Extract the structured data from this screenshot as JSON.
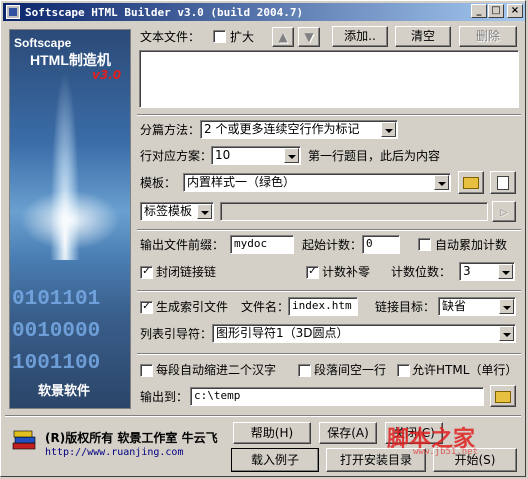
{
  "window": {
    "title": "Softscape HTML Builder v3.0 (build 2004.7)",
    "controls": [
      "_",
      "□",
      "×"
    ]
  },
  "sidebar": {
    "brand": "Softscape",
    "product": "HTML制造机",
    "version": "v3.0",
    "binary_lines": [
      "0101101",
      "0010000",
      "1001100"
    ],
    "company": "软景软件"
  },
  "text_files": {
    "label": "文本文件：",
    "expand_label": "扩大",
    "expand_checked": false,
    "up_icon": "up-arrow-icon",
    "down_icon": "down-arrow-icon",
    "add_label": "添加..",
    "clear_label": "清空",
    "delete_label": "删除"
  },
  "split": {
    "label": "分篇方法：",
    "value": "2 个或更多连续空行作为标记"
  },
  "line_map": {
    "label": "行对应方案：",
    "value": "10",
    "description": "第一行题目，此后为内容"
  },
  "template": {
    "label": "模板：",
    "value": "内置样式一（绿色）",
    "open_icon": "folder-open-icon",
    "preview_icon": "preview-icon"
  },
  "tag_template": {
    "value": "标签模板",
    "play_icon": "play-icon"
  },
  "output_prefix": {
    "label": "输出文件前缀：",
    "value": "mydoc",
    "start_label": "起始计数：",
    "start_value": "0",
    "auto_label": "自动累加计数",
    "auto_checked": false
  },
  "options": {
    "close_link_label": "封闭链接链",
    "close_link_checked": true,
    "zero_pad_label": "计数补零",
    "zero_pad_checked": true,
    "digits_label": "计数位数：",
    "digits_value": "3"
  },
  "index": {
    "gen_label": "生成索引文件",
    "gen_checked": true,
    "filename_label": "文件名：",
    "filename_value": "index.htm",
    "target_label": "链接目标：",
    "target_value": "缺省"
  },
  "list_guide": {
    "label": "列表引导符：",
    "value": "图形引导符1（3D圆点）"
  },
  "paragraph": {
    "indent_label": "每段自动缩进二个汉字",
    "indent_checked": false,
    "blank_label": "段落间空一行",
    "blank_checked": false,
    "html_label": "允许HTML（单行）",
    "html_checked": false
  },
  "output": {
    "label": "输出到：",
    "value": "c:\\temp",
    "browse_icon": "folder-icon"
  },
  "bottom": {
    "copyright": "(R)版权所有 软景工作室 牛云飞",
    "url": "http://www.ruanjing.com",
    "help_label": "帮助(H)",
    "save_label": "保存(A)",
    "close_label": "关闭(C)",
    "load_example_label": "载入例子",
    "open_dir_label": "打开安装目录",
    "start_label": "开始(S)"
  },
  "watermark": {
    "text": "脚本之家",
    "url": "www.jb51.net"
  },
  "colors": {
    "titlebar_start": "#0a246a",
    "titlebar_end": "#a6caf0",
    "face": "#d4d0c8",
    "version_red": "#e02020"
  }
}
